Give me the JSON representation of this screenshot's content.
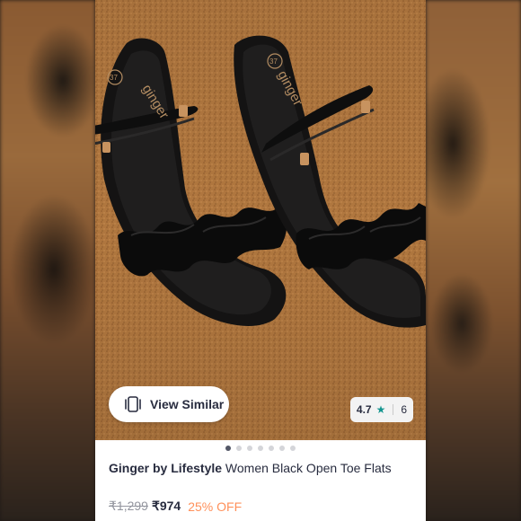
{
  "product": {
    "brand": "Ginger by Lifestyle",
    "title_rest": " Women Black Open Toe Flats",
    "mrp": "₹1,299",
    "price": "₹974",
    "discount": "25% OFF",
    "image_alt": "Black ruffle strap flats",
    "insole_logo": "ginger",
    "size_mark": "37"
  },
  "actions": {
    "view_similar_label": "View Similar",
    "view_similar_icon": "similar-stack-icon"
  },
  "rating": {
    "score": "4.7",
    "count": "6",
    "star_icon": "star-icon",
    "star_color": "#14958f"
  },
  "carousel": {
    "total_dots": 7,
    "active_index": 0
  },
  "colors": {
    "discount": "#ff905a",
    "text": "#282c3f",
    "mrp": "#94969f"
  }
}
